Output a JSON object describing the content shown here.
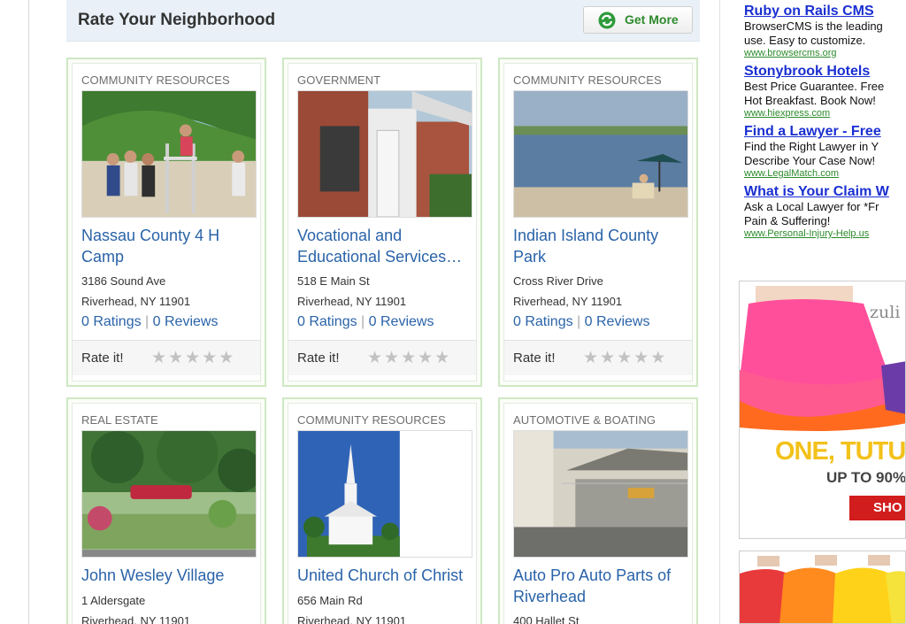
{
  "header": {
    "title": "Rate Your Neighborhood",
    "get_more_label": "Get More"
  },
  "listings": [
    {
      "category": "COMMUNITY RESOURCES",
      "name": "Nassau County 4 H Camp",
      "address1": "3186 Sound Ave",
      "address2": "Riverhead, NY 11901",
      "ratings": "0 Ratings",
      "separator": "|",
      "reviews": "0 Reviews",
      "rate_label": "Rate it!",
      "photo": "camp-group-photo"
    },
    {
      "category": "GOVERNMENT",
      "name": "Vocational and Educational Services…",
      "address1": "518 E Main St",
      "address2": "Riverhead, NY 11901",
      "ratings": "0 Ratings",
      "separator": "|",
      "reviews": "0 Reviews",
      "rate_label": "Rate it!",
      "photo": "brick-building-photo"
    },
    {
      "category": "COMMUNITY RESOURCES",
      "name": "Indian Island County Park",
      "address1": "Cross River Drive",
      "address2": "Riverhead, NY 11901",
      "ratings": "0 Ratings",
      "separator": "|",
      "reviews": "0 Reviews",
      "rate_label": "Rate it!",
      "photo": "beach-photo"
    },
    {
      "category": "REAL ESTATE",
      "name": "John Wesley Village",
      "address1": "1 Aldersgate",
      "address2": "Riverhead, NY 11901",
      "photo": "village-sign-photo"
    },
    {
      "category": "COMMUNITY RESOURCES",
      "name": "United Church of Christ",
      "address1": "656 Main Rd",
      "address2": "Riverhead, NY 11901",
      "photo": "church-photo"
    },
    {
      "category": "AUTOMOTIVE & BOATING",
      "name": "Auto Pro Auto Parts of Riverhead",
      "address1": "400 Hallet St",
      "photo": "auto-shop-photo"
    }
  ],
  "ads": [
    {
      "title": "Ruby on Rails CMS",
      "line1": "BrowserCMS is the leading",
      "line2": "use. Easy to customize.",
      "url": "www.browsercms.org"
    },
    {
      "title": "Stonybrook Hotels",
      "line1": "Best Price Guarantee. Free",
      "line2": "Hot Breakfast. Book Now!",
      "url": "www.hiexpress.com"
    },
    {
      "title": "Find a Lawyer - Free",
      "line1": "Find the Right Lawyer in Y",
      "line2": "Describe Your Case Now!",
      "url": "www.LegalMatch.com"
    },
    {
      "title": "What is Your Claim W",
      "line1": "Ask a Local Lawyer for *Fr",
      "line2": "Pain & Suffering!",
      "url": "www.Personal-Injury-Help.us"
    }
  ],
  "banner": {
    "brand": "zuli",
    "headline": "ONE, TUTU",
    "sub": "UP TO 90%",
    "cta": "SHO"
  },
  "colors": {
    "link": "#2a63a8",
    "card_border": "#cfe8c4",
    "header_bg": "#e9f0f7",
    "ad_title": "#1a2fd1",
    "ad_url": "#2b8a2b"
  }
}
